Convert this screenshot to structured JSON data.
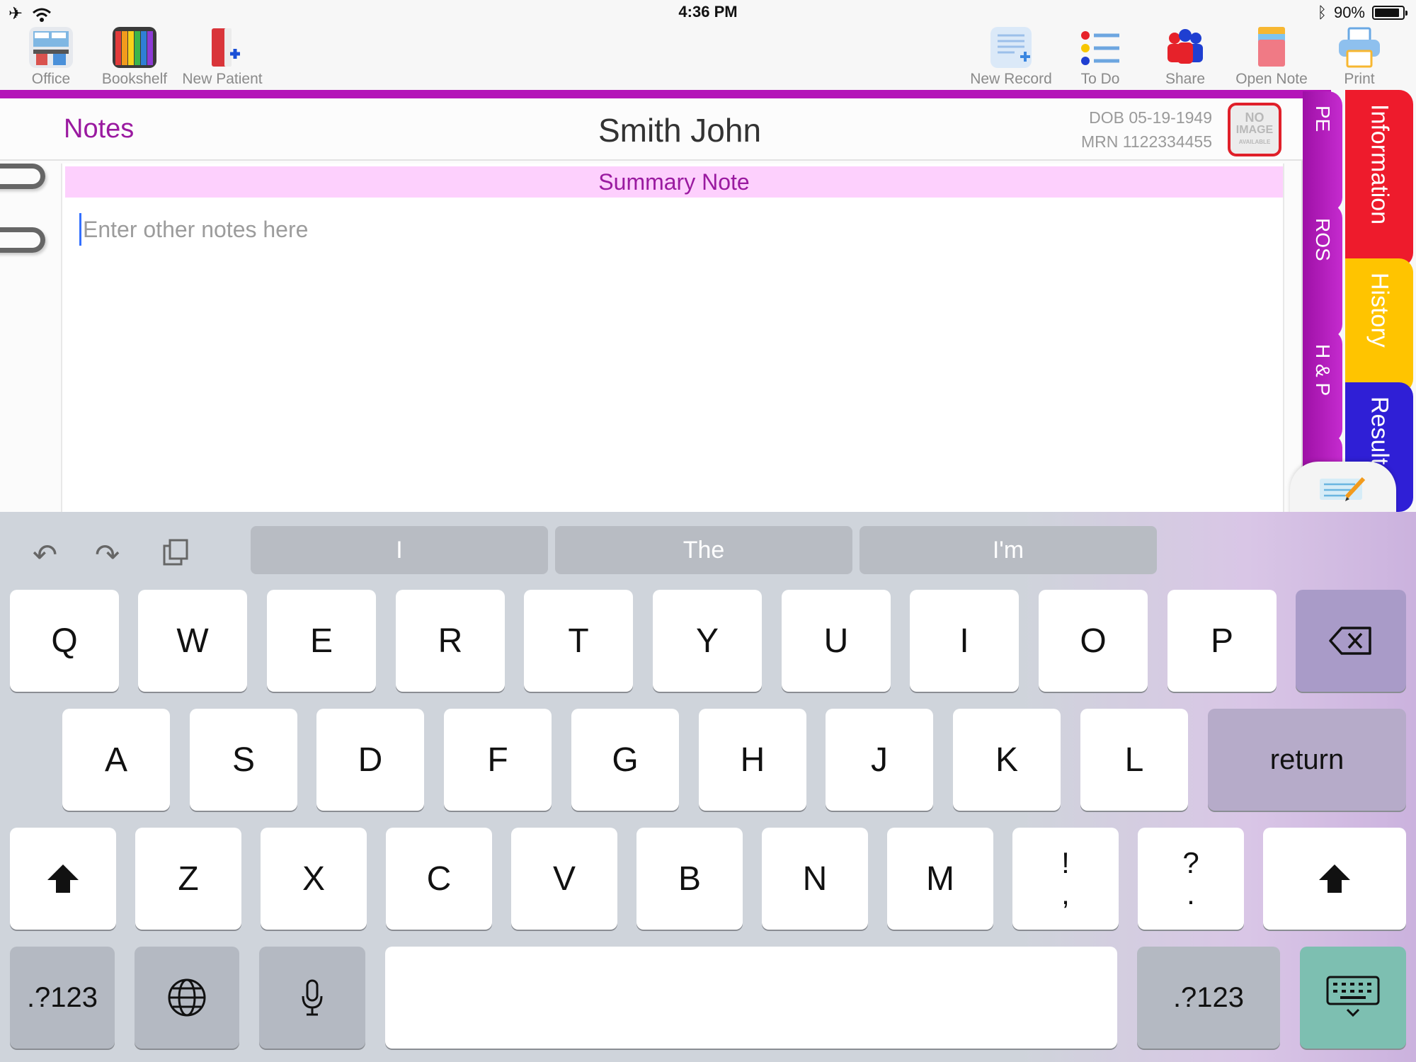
{
  "status": {
    "time": "4:36 PM",
    "battery": "90%",
    "battery_fraction": 0.9
  },
  "toolbar": {
    "left": [
      {
        "name": "office",
        "label": "Office"
      },
      {
        "name": "bookshelf",
        "label": "Bookshelf"
      },
      {
        "name": "new-patient",
        "label": "New Patient"
      }
    ],
    "right": [
      {
        "name": "new-record",
        "label": "New Record"
      },
      {
        "name": "to-do",
        "label": "To Do"
      },
      {
        "name": "share",
        "label": "Share"
      },
      {
        "name": "open-note",
        "label": "Open Note"
      },
      {
        "name": "print",
        "label": "Print"
      }
    ]
  },
  "header": {
    "notes": "Notes",
    "patient": "Smith John",
    "dob": "DOB 05-19-1949",
    "mrn": "MRN 1122334455",
    "photo_line1": "NO",
    "photo_line2": "IMAGE",
    "photo_line3": "AVAILABLE"
  },
  "note": {
    "section_title": "Summary Note",
    "placeholder": "Enter other notes here"
  },
  "tabs": {
    "inner": [
      "PE",
      "ROS",
      "H & P"
    ],
    "outer": [
      "Information",
      "History",
      "Results"
    ]
  },
  "colors": {
    "accent": "#b414b8",
    "information": "#ee1b2c",
    "history": "#ffc400",
    "results": "#2f1fd6"
  },
  "keyboard": {
    "suggestions": [
      "I",
      "The",
      "I'm"
    ],
    "row1": [
      "Q",
      "W",
      "E",
      "R",
      "T",
      "Y",
      "U",
      "I",
      "O",
      "P"
    ],
    "row2": [
      "A",
      "S",
      "D",
      "F",
      "G",
      "H",
      "J",
      "K",
      "L"
    ],
    "row3": [
      "Z",
      "X",
      "C",
      "V",
      "B",
      "N",
      "M"
    ],
    "punct1": [
      "!",
      ","
    ],
    "punct2": [
      "?",
      "."
    ],
    "return": "return",
    "numbers": ".?123"
  }
}
